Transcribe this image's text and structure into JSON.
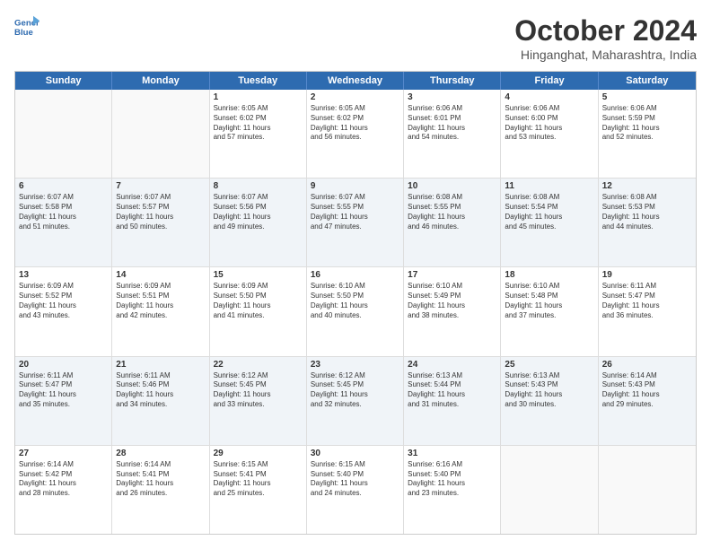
{
  "header": {
    "logo_line1": "General",
    "logo_line2": "Blue",
    "month": "October 2024",
    "location": "Hinganghat, Maharashtra, India"
  },
  "days_of_week": [
    "Sunday",
    "Monday",
    "Tuesday",
    "Wednesday",
    "Thursday",
    "Friday",
    "Saturday"
  ],
  "weeks": [
    [
      {
        "day": "",
        "content": ""
      },
      {
        "day": "",
        "content": ""
      },
      {
        "day": "1",
        "content": "Sunrise: 6:05 AM\nSunset: 6:02 PM\nDaylight: 11 hours\nand 57 minutes."
      },
      {
        "day": "2",
        "content": "Sunrise: 6:05 AM\nSunset: 6:02 PM\nDaylight: 11 hours\nand 56 minutes."
      },
      {
        "day": "3",
        "content": "Sunrise: 6:06 AM\nSunset: 6:01 PM\nDaylight: 11 hours\nand 54 minutes."
      },
      {
        "day": "4",
        "content": "Sunrise: 6:06 AM\nSunset: 6:00 PM\nDaylight: 11 hours\nand 53 minutes."
      },
      {
        "day": "5",
        "content": "Sunrise: 6:06 AM\nSunset: 5:59 PM\nDaylight: 11 hours\nand 52 minutes."
      }
    ],
    [
      {
        "day": "6",
        "content": "Sunrise: 6:07 AM\nSunset: 5:58 PM\nDaylight: 11 hours\nand 51 minutes."
      },
      {
        "day": "7",
        "content": "Sunrise: 6:07 AM\nSunset: 5:57 PM\nDaylight: 11 hours\nand 50 minutes."
      },
      {
        "day": "8",
        "content": "Sunrise: 6:07 AM\nSunset: 5:56 PM\nDaylight: 11 hours\nand 49 minutes."
      },
      {
        "day": "9",
        "content": "Sunrise: 6:07 AM\nSunset: 5:55 PM\nDaylight: 11 hours\nand 47 minutes."
      },
      {
        "day": "10",
        "content": "Sunrise: 6:08 AM\nSunset: 5:55 PM\nDaylight: 11 hours\nand 46 minutes."
      },
      {
        "day": "11",
        "content": "Sunrise: 6:08 AM\nSunset: 5:54 PM\nDaylight: 11 hours\nand 45 minutes."
      },
      {
        "day": "12",
        "content": "Sunrise: 6:08 AM\nSunset: 5:53 PM\nDaylight: 11 hours\nand 44 minutes."
      }
    ],
    [
      {
        "day": "13",
        "content": "Sunrise: 6:09 AM\nSunset: 5:52 PM\nDaylight: 11 hours\nand 43 minutes."
      },
      {
        "day": "14",
        "content": "Sunrise: 6:09 AM\nSunset: 5:51 PM\nDaylight: 11 hours\nand 42 minutes."
      },
      {
        "day": "15",
        "content": "Sunrise: 6:09 AM\nSunset: 5:50 PM\nDaylight: 11 hours\nand 41 minutes."
      },
      {
        "day": "16",
        "content": "Sunrise: 6:10 AM\nSunset: 5:50 PM\nDaylight: 11 hours\nand 40 minutes."
      },
      {
        "day": "17",
        "content": "Sunrise: 6:10 AM\nSunset: 5:49 PM\nDaylight: 11 hours\nand 38 minutes."
      },
      {
        "day": "18",
        "content": "Sunrise: 6:10 AM\nSunset: 5:48 PM\nDaylight: 11 hours\nand 37 minutes."
      },
      {
        "day": "19",
        "content": "Sunrise: 6:11 AM\nSunset: 5:47 PM\nDaylight: 11 hours\nand 36 minutes."
      }
    ],
    [
      {
        "day": "20",
        "content": "Sunrise: 6:11 AM\nSunset: 5:47 PM\nDaylight: 11 hours\nand 35 minutes."
      },
      {
        "day": "21",
        "content": "Sunrise: 6:11 AM\nSunset: 5:46 PM\nDaylight: 11 hours\nand 34 minutes."
      },
      {
        "day": "22",
        "content": "Sunrise: 6:12 AM\nSunset: 5:45 PM\nDaylight: 11 hours\nand 33 minutes."
      },
      {
        "day": "23",
        "content": "Sunrise: 6:12 AM\nSunset: 5:45 PM\nDaylight: 11 hours\nand 32 minutes."
      },
      {
        "day": "24",
        "content": "Sunrise: 6:13 AM\nSunset: 5:44 PM\nDaylight: 11 hours\nand 31 minutes."
      },
      {
        "day": "25",
        "content": "Sunrise: 6:13 AM\nSunset: 5:43 PM\nDaylight: 11 hours\nand 30 minutes."
      },
      {
        "day": "26",
        "content": "Sunrise: 6:14 AM\nSunset: 5:43 PM\nDaylight: 11 hours\nand 29 minutes."
      }
    ],
    [
      {
        "day": "27",
        "content": "Sunrise: 6:14 AM\nSunset: 5:42 PM\nDaylight: 11 hours\nand 28 minutes."
      },
      {
        "day": "28",
        "content": "Sunrise: 6:14 AM\nSunset: 5:41 PM\nDaylight: 11 hours\nand 26 minutes."
      },
      {
        "day": "29",
        "content": "Sunrise: 6:15 AM\nSunset: 5:41 PM\nDaylight: 11 hours\nand 25 minutes."
      },
      {
        "day": "30",
        "content": "Sunrise: 6:15 AM\nSunset: 5:40 PM\nDaylight: 11 hours\nand 24 minutes."
      },
      {
        "day": "31",
        "content": "Sunrise: 6:16 AM\nSunset: 5:40 PM\nDaylight: 11 hours\nand 23 minutes."
      },
      {
        "day": "",
        "content": ""
      },
      {
        "day": "",
        "content": ""
      }
    ]
  ]
}
